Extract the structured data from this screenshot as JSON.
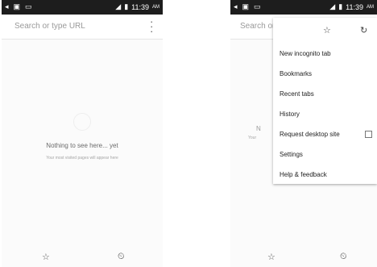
{
  "status_bar": {
    "time": "11:39",
    "ampm": "AM",
    "icons_left": [
      "notification-icon",
      "lock-icon",
      "message-icon"
    ],
    "icons_right": [
      "signal-icon",
      "battery-icon"
    ]
  },
  "left_screen": {
    "omnibox": {
      "placeholder": "Search or type URL"
    },
    "ntp": {
      "title": "Nothing to see here... yet",
      "subtitle": "Your most visited pages will appear here"
    },
    "bottom_bar": [
      "bookmarks-star-icon",
      "history-clock-icon"
    ]
  },
  "right_screen": {
    "omnibox": {
      "partial_text": "Search or"
    },
    "ntp_partial": {
      "title": "N",
      "subtitle": "Your"
    },
    "menu": {
      "top_icons": [
        "star-icon",
        "reload-icon"
      ],
      "items": [
        {
          "label": "New incognito tab"
        },
        {
          "label": "Bookmarks"
        },
        {
          "label": "Recent tabs"
        },
        {
          "label": "History"
        },
        {
          "label": "Request desktop site",
          "checkbox": false
        },
        {
          "label": "Settings"
        },
        {
          "label": "Help & feedback"
        }
      ]
    }
  }
}
